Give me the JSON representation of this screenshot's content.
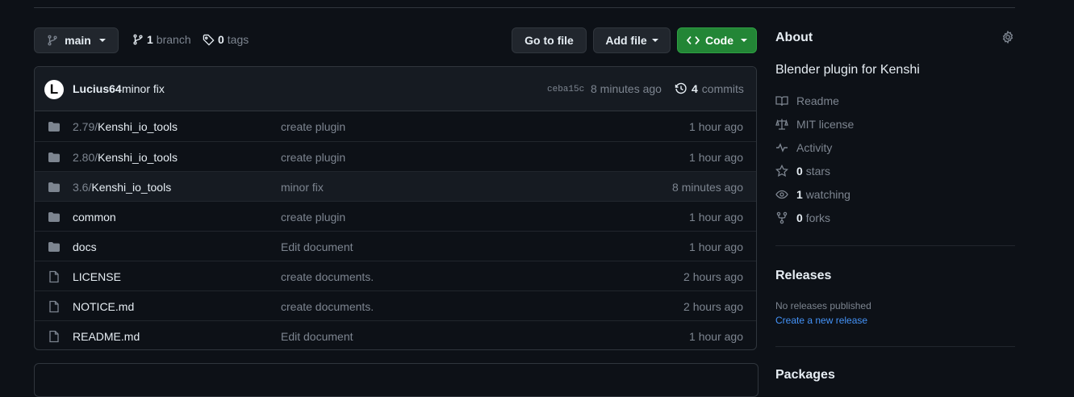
{
  "toolbar": {
    "branch_label": "main",
    "branches_count": "1",
    "branches_label": "branch",
    "tags_count": "0",
    "tags_label": "tags",
    "goto_label": "Go to file",
    "add_label": "Add file",
    "code_label": "Code"
  },
  "commit": {
    "avatar_letter": "L",
    "author": "Lucius64",
    "message": "minor fix",
    "sha": "ceba15c",
    "time": "8 minutes ago",
    "count": "4",
    "count_label": "commits"
  },
  "files": [
    {
      "type": "folder",
      "prefix": "2.79/",
      "name": "Kenshi_io_tools",
      "message": "create plugin",
      "age": "1 hour ago"
    },
    {
      "type": "folder",
      "prefix": "2.80/",
      "name": "Kenshi_io_tools",
      "message": "create plugin",
      "age": "1 hour ago"
    },
    {
      "type": "folder",
      "prefix": "3.6/",
      "name": "Kenshi_io_tools",
      "message": "minor fix",
      "age": "8 minutes ago"
    },
    {
      "type": "folder",
      "prefix": "",
      "name": "common",
      "message": "create plugin",
      "age": "1 hour ago"
    },
    {
      "type": "folder",
      "prefix": "",
      "name": "docs",
      "message": "Edit document",
      "age": "1 hour ago"
    },
    {
      "type": "file",
      "prefix": "",
      "name": "LICENSE",
      "message": "create documents.",
      "age": "2 hours ago"
    },
    {
      "type": "file",
      "prefix": "",
      "name": "NOTICE.md",
      "message": "create documents.",
      "age": "2 hours ago"
    },
    {
      "type": "file",
      "prefix": "",
      "name": "README.md",
      "message": "Edit document",
      "age": "1 hour ago"
    }
  ],
  "about": {
    "title": "About",
    "description": "Blender plugin for Kenshi",
    "readme": "Readme",
    "license": "MIT license",
    "activity": "Activity",
    "stars_count": "0",
    "stars_label": "stars",
    "watching_count": "1",
    "watching_label": "watching",
    "forks_count": "0",
    "forks_label": "forks"
  },
  "releases": {
    "title": "Releases",
    "none_text": "No releases published",
    "create_link": "Create a new release"
  },
  "packages": {
    "title": "Packages"
  },
  "colors": {
    "background": "#0d1117",
    "border": "#30363d",
    "muted_text": "#7d8590",
    "code_button": "#238636",
    "link": "#4493f8"
  }
}
